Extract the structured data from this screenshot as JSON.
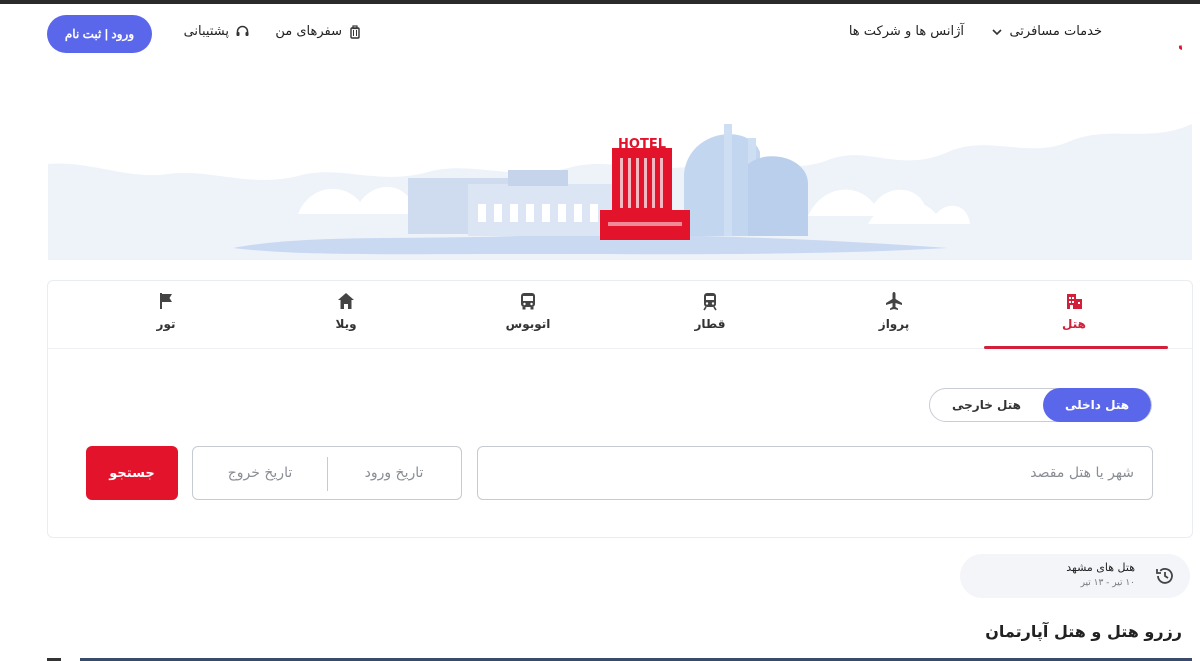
{
  "header": {
    "logo_text": "اسنپ! تریپ",
    "services_label": "خدمات مسافرتی",
    "agencies_label": "آژانس ها و شرکت ها",
    "trips_label": "سفرهای من",
    "support_label": "پشتیبانی",
    "login_label": "ورود | ثبت نام"
  },
  "hero": {
    "hotel_sign": "HOTEL"
  },
  "tabs": [
    {
      "label": "هتل",
      "icon": "building-icon",
      "active": true
    },
    {
      "label": "پرواز",
      "icon": "airplane-icon",
      "active": false
    },
    {
      "label": "قطار",
      "icon": "train-icon",
      "active": false
    },
    {
      "label": "اتوبوس",
      "icon": "bus-icon",
      "active": false
    },
    {
      "label": "ویلا",
      "icon": "house-icon",
      "active": false
    },
    {
      "label": "تور",
      "icon": "flag-icon",
      "active": false
    }
  ],
  "search": {
    "domestic_label": "هتل داخلی",
    "foreign_label": "هتل خارجی",
    "destination_placeholder": "شهر یا هتل مقصد",
    "checkin_placeholder": "تاریخ ورود",
    "checkout_placeholder": "تاریخ خروج",
    "submit_label": "جستجو"
  },
  "recent": {
    "title": "هتل های مشهد",
    "dates": "۱۰ تیر - ۱۳ تیر"
  },
  "section_title": "رزرو هتل و هتل آپارتمان",
  "colors": {
    "brand_red": "#e3132c",
    "accent_blue": "#5b67ea",
    "tab_active": "#d31f3a"
  }
}
